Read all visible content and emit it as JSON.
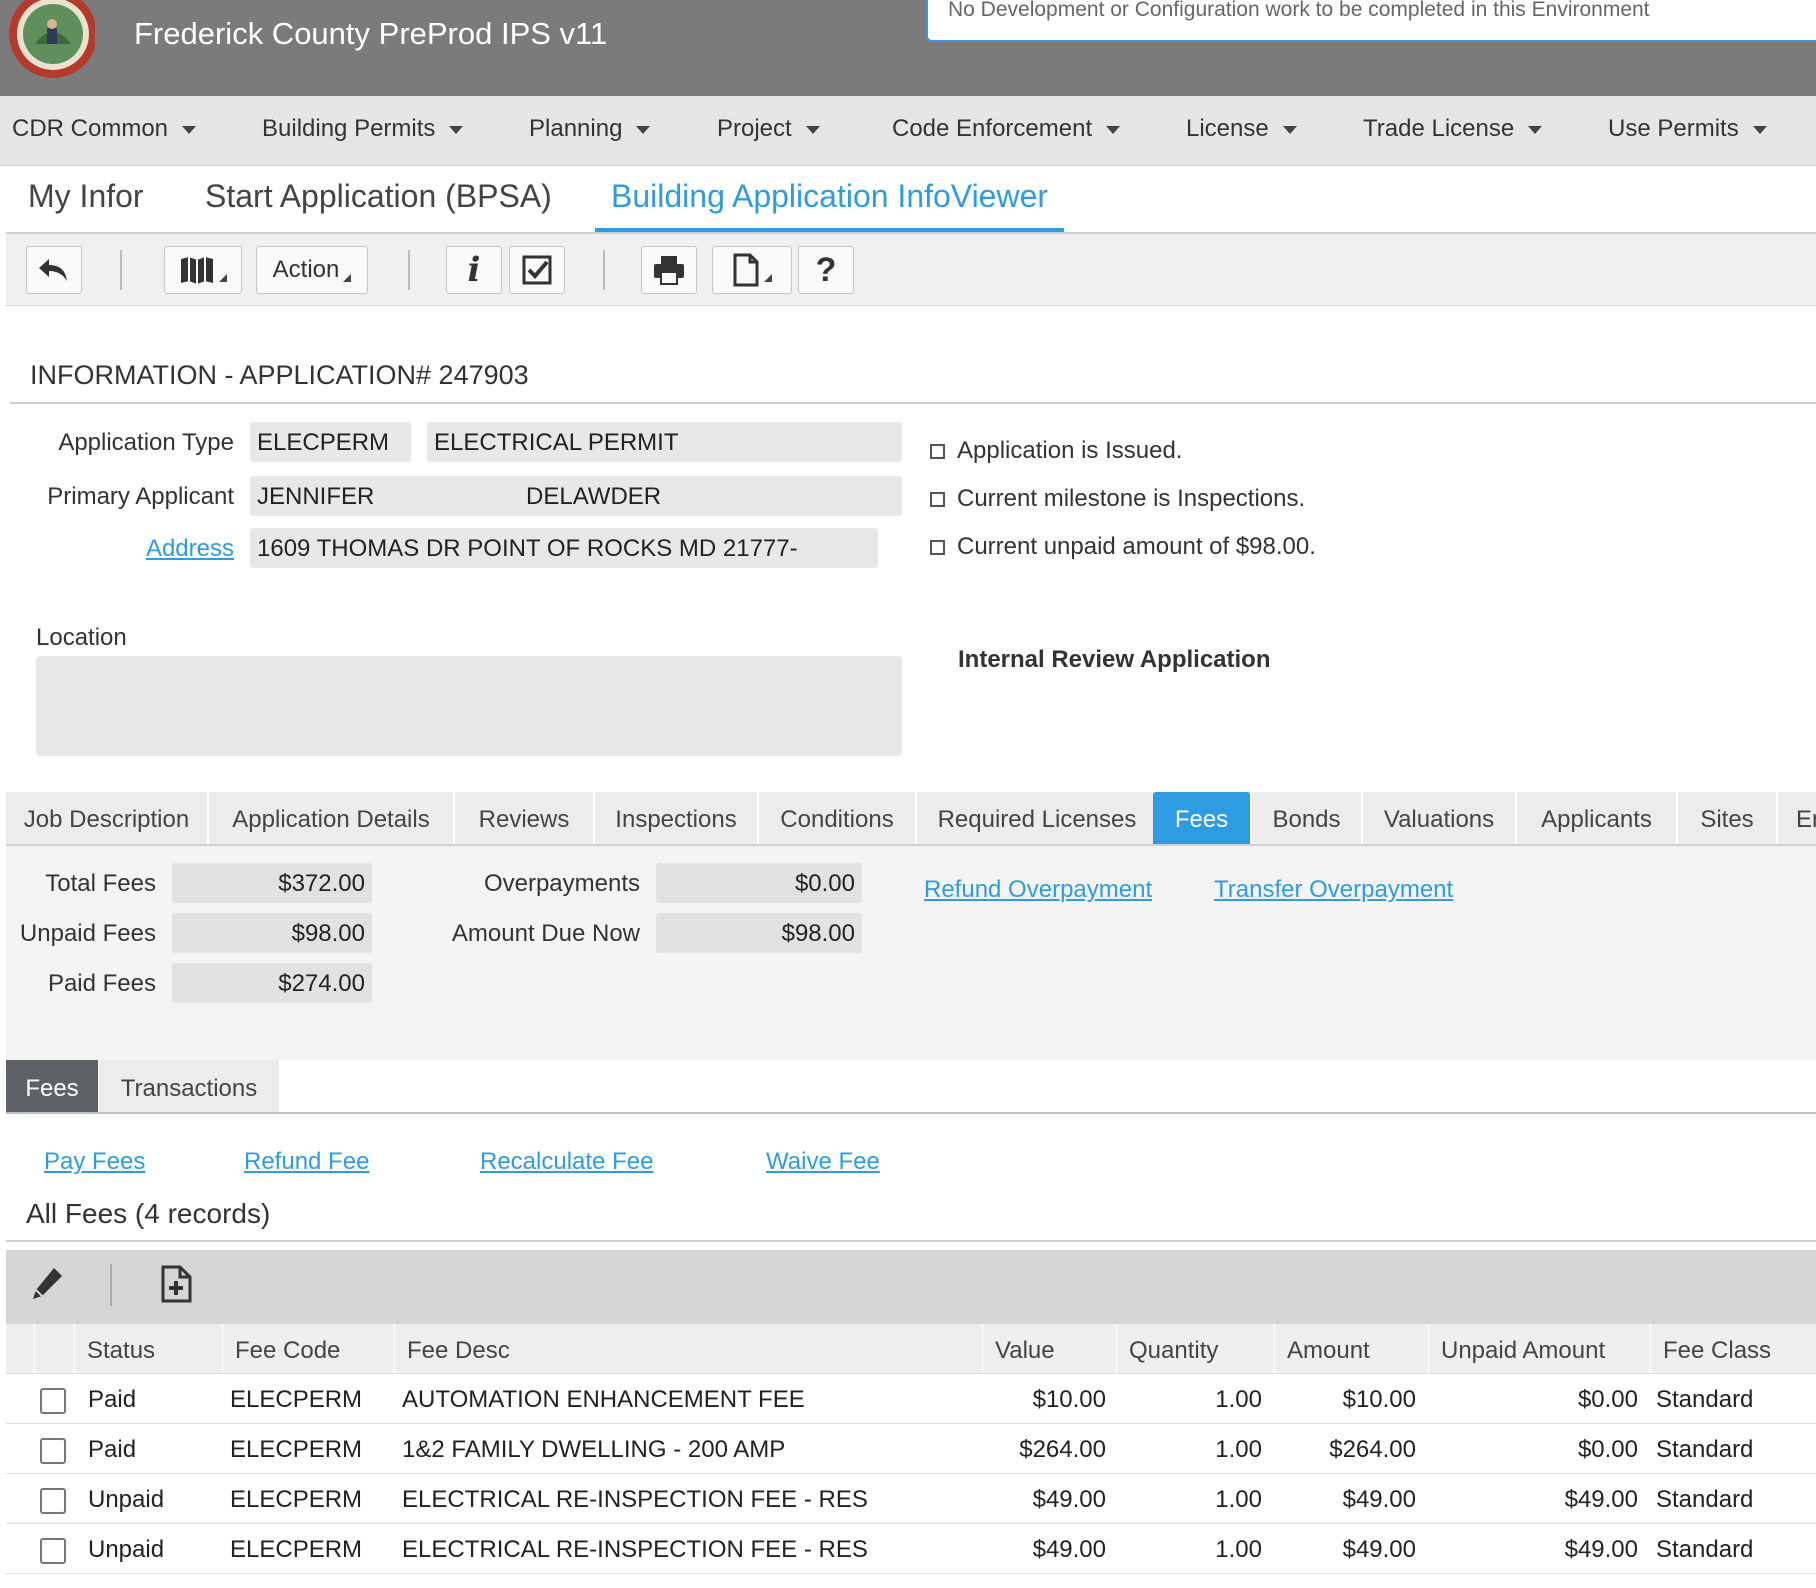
{
  "header": {
    "title": "Frederick County PreProd IPS v11",
    "banner": "No Development or Configuration work to be completed in this Environment"
  },
  "main_menu": [
    {
      "label": "CDR Common"
    },
    {
      "label": "Building Permits"
    },
    {
      "label": "Planning"
    },
    {
      "label": "Project"
    },
    {
      "label": "Code Enforcement"
    },
    {
      "label": "License"
    },
    {
      "label": "Trade License"
    },
    {
      "label": "Use Permits"
    }
  ],
  "page_tabs": [
    {
      "label": "My Infor"
    },
    {
      "label": "Start Application (BPSA)"
    },
    {
      "label": "Building Application InfoViewer",
      "active": true
    }
  ],
  "toolbar": {
    "action_label": "Action",
    "help_label": "?"
  },
  "info": {
    "section_title": "INFORMATION - APPLICATION# 247903",
    "app_type_label": "Application Type",
    "app_type_code": "ELECPERM",
    "app_type_desc": "ELECTRICAL PERMIT",
    "applicant_label": "Primary Applicant",
    "applicant_first": "JENNIFER",
    "applicant_last": "DELAWDER",
    "address_label": "Address",
    "address_value": "1609 THOMAS DR POINT OF ROCKS MD 21777-",
    "location_label": "Location",
    "status_lines": [
      "Application is Issued.",
      "Current milestone is Inspections.",
      "Current unpaid amount of $98.00."
    ],
    "review_title": "Internal Review Application"
  },
  "detail_tabs": [
    {
      "label": "Job Description"
    },
    {
      "label": "Application Details"
    },
    {
      "label": "Reviews"
    },
    {
      "label": "Inspections"
    },
    {
      "label": "Conditions"
    },
    {
      "label": "Required Licenses"
    },
    {
      "label": "Fees",
      "active": true
    },
    {
      "label": "Bonds"
    },
    {
      "label": "Valuations"
    },
    {
      "label": "Applicants"
    },
    {
      "label": "Sites"
    },
    {
      "label": "En"
    }
  ],
  "fees_summary": {
    "total_label": "Total Fees",
    "total": "$372.00",
    "unpaid_label": "Unpaid Fees",
    "unpaid": "$98.00",
    "paid_label": "Paid Fees",
    "paid": "$274.00",
    "overpay_label": "Overpayments",
    "overpay": "$0.00",
    "due_label": "Amount Due Now",
    "due": "$98.00",
    "refund_overpayment": "Refund Overpayment",
    "transfer_overpayment": "Transfer Overpayment"
  },
  "sub_tabs": [
    {
      "label": "Fees",
      "active": true
    },
    {
      "label": "Transactions"
    }
  ],
  "fee_actions": {
    "pay": "Pay Fees",
    "refund": "Refund Fee",
    "recalculate": "Recalculate Fee",
    "waive": "Waive Fee"
  },
  "records_title": "All Fees (4 records)",
  "grid": {
    "columns": [
      "Status",
      "Fee Code",
      "Fee Desc",
      "Value",
      "Quantity",
      "Amount",
      "Unpaid Amount",
      "Fee Class"
    ],
    "rows": [
      [
        "Paid",
        "ELECPERM",
        "AUTOMATION ENHANCEMENT FEE",
        "$10.00",
        "1.00",
        "$10.00",
        "$0.00",
        "Standard"
      ],
      [
        "Paid",
        "ELECPERM",
        "1&2 FAMILY DWELLING - 200 AMP",
        "$264.00",
        "1.00",
        "$264.00",
        "$0.00",
        "Standard"
      ],
      [
        "Unpaid",
        "ELECPERM",
        "ELECTRICAL RE-INSPECTION FEE - RES",
        "$49.00",
        "1.00",
        "$49.00",
        "$49.00",
        "Standard"
      ],
      [
        "Unpaid",
        "ELECPERM",
        "ELECTRICAL RE-INSPECTION FEE - RES",
        "$49.00",
        "1.00",
        "$49.00",
        "$49.00",
        "Standard"
      ]
    ]
  },
  "colors": {
    "accent": "#2e9ce0",
    "header_bg": "#7b7b7b",
    "active_subtab": "#5f6168"
  }
}
